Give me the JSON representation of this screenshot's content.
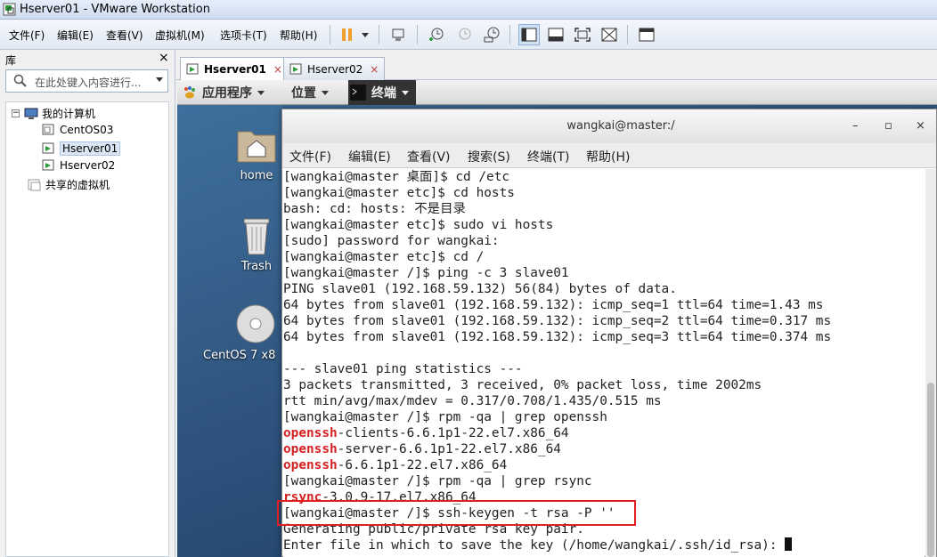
{
  "window": {
    "title": "Hserver01 - VMware Workstation"
  },
  "menubar": {
    "items": [
      "文件(F)",
      "编辑(E)",
      "查看(V)",
      "虚拟机(M)",
      "选项卡(T)",
      "帮助(H)"
    ],
    "toolbar_icons": [
      "pause-icon",
      "send-ctrl-alt-del-icon",
      "snapshot-take-icon",
      "snapshot-revert-icon",
      "snapshot-manager-icon",
      "view-library-icon",
      "view-console-icon",
      "fullscreen-icon",
      "unity-icon",
      "thumbnail-icon"
    ]
  },
  "library": {
    "header": "库",
    "close": "×",
    "search_placeholder": "在此处键入内容进行...",
    "tree": {
      "root": "我的计算机",
      "children": [
        "CentOS03",
        "Hserver01",
        "Hserver02"
      ],
      "selected": "Hserver01",
      "shared": "共享的虚拟机"
    }
  },
  "tabs": [
    {
      "label": "Hserver01",
      "active": true,
      "close": "×"
    },
    {
      "label": "Hserver02",
      "active": false,
      "close": "×"
    }
  ],
  "gnome_panel": {
    "apps": "应用程序",
    "places": "位置",
    "terminal": "终端"
  },
  "desktop_icons": [
    {
      "label": "home",
      "icon": "home-folder-icon"
    },
    {
      "label": "Trash",
      "icon": "trash-icon"
    },
    {
      "label": "CentOS 7 x8",
      "icon": "disc-icon"
    }
  ],
  "terminal": {
    "title": "wangkai@master:/",
    "controls": [
      "–",
      "▫",
      "×"
    ],
    "menu": [
      "文件(F)",
      "编辑(E)",
      "查看(V)",
      "搜索(S)",
      "终端(T)",
      "帮助(H)"
    ],
    "lines": [
      {
        "text": "[wangkai@master 桌面]$ cd /etc"
      },
      {
        "text": "[wangkai@master etc]$ cd hosts"
      },
      {
        "text": "bash: cd: hosts: 不是目录"
      },
      {
        "text": "[wangkai@master etc]$ sudo vi hosts"
      },
      {
        "text": "[sudo] password for wangkai:"
      },
      {
        "text": "[wangkai@master etc]$ cd /"
      },
      {
        "text": "[wangkai@master /]$ ping -c 3 slave01"
      },
      {
        "text": "PING slave01 (192.168.59.132) 56(84) bytes of data."
      },
      {
        "text": "64 bytes from slave01 (192.168.59.132): icmp_seq=1 ttl=64 time=1.43 ms"
      },
      {
        "text": "64 bytes from slave01 (192.168.59.132): icmp_seq=2 ttl=64 time=0.317 ms"
      },
      {
        "text": "64 bytes from slave01 (192.168.59.132): icmp_seq=3 ttl=64 time=0.374 ms"
      },
      {
        "text": ""
      },
      {
        "text": "--- slave01 ping statistics ---"
      },
      {
        "text": "3 packets transmitted, 3 received, 0% packet loss, time 2002ms"
      },
      {
        "text": "rtt min/avg/max/mdev = 0.317/0.708/1.435/0.515 ms"
      },
      {
        "text": "[wangkai@master /]$ rpm -qa | grep openssh"
      },
      {
        "red": "openssh",
        "text": "-clients-6.6.1p1-22.el7.x86_64"
      },
      {
        "red": "openssh",
        "text": "-server-6.6.1p1-22.el7.x86_64"
      },
      {
        "red": "openssh",
        "text": "-6.6.1p1-22.el7.x86_64"
      },
      {
        "text": "[wangkai@master /]$ rpm -qa | grep rsync"
      },
      {
        "red": "rsync",
        "text": "-3.0.9-17.el7.x86_64"
      },
      {
        "text": "[wangkai@master /]$ ssh-keygen -t rsa -P ''"
      },
      {
        "text": "Generating public/private rsa key pair."
      },
      {
        "text": "Enter file in which to save the key (/home/wangkai/.ssh/id_rsa): ",
        "cursor": true
      }
    ],
    "highlight_color": "#e02020"
  }
}
